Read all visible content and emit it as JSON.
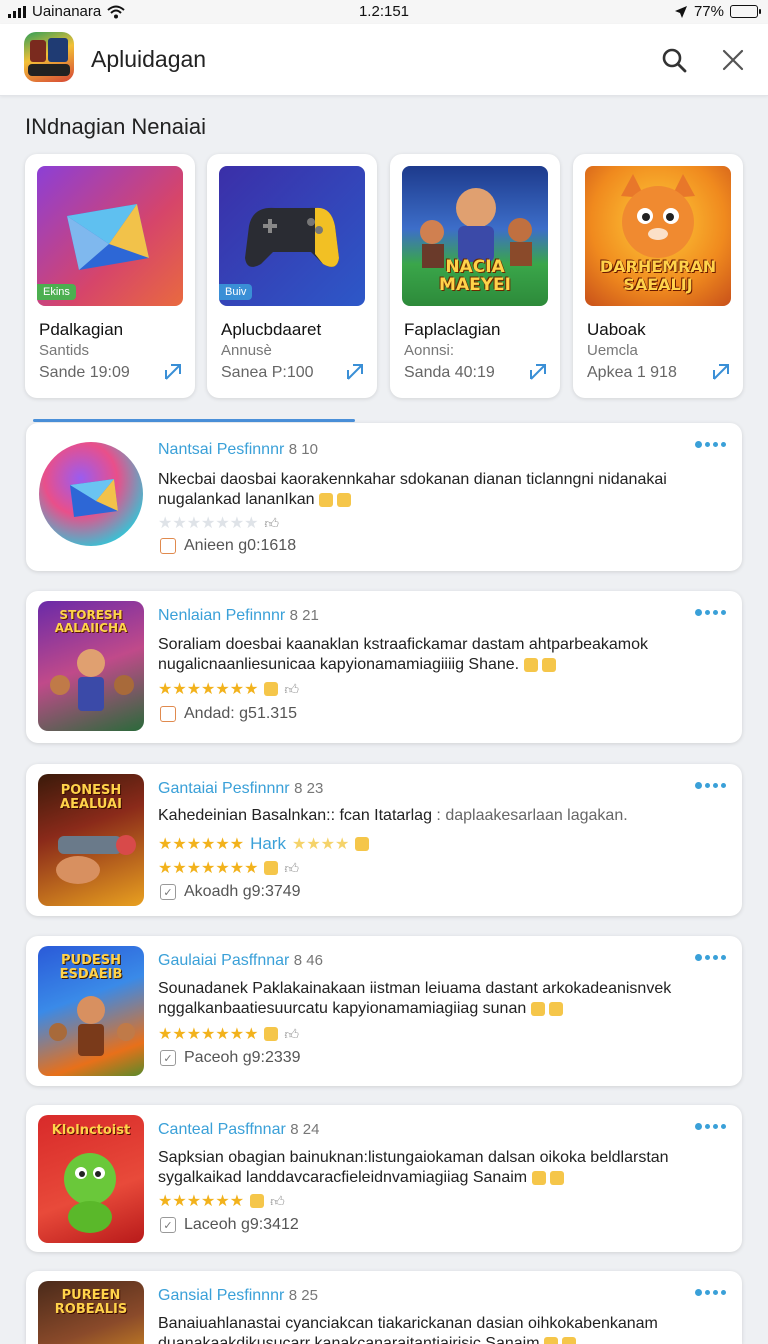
{
  "status": {
    "carrier": "Uainanara",
    "time": "1.2:151",
    "battery": "77%"
  },
  "header": {
    "title": "Apluidagan"
  },
  "section_title": "INdnagian Nenaiai",
  "featured": [
    {
      "name": "Pdalkagian",
      "sub": "Santids",
      "meta": "Sande 19:09",
      "tag": "Ekins"
    },
    {
      "name": "Aplucbdaaret",
      "sub": "Annusè",
      "meta": "Sanea P:100",
      "tag": "Buiv"
    },
    {
      "name": "Faplaclagian",
      "sub": "Aonnsi:",
      "meta": "Sanda 40:19",
      "art": "NACIA MAEYEI"
    },
    {
      "name": "Uaboak",
      "sub": "Uemcla",
      "meta": "Apkea 1 918",
      "art": "DARHEMRAN SAEALIJ"
    }
  ],
  "list": [
    {
      "title": "Nantsai Pesfinnnr",
      "num": "8 10",
      "desc1": "Nkecbai daosbai kaorakennkahar sdokanan dianan ticlanngni nidanakai",
      "desc2": "nugalankad lananIkan",
      "meta": "Anieen g0:1618"
    },
    {
      "title": "Nenlaian Pefinnnr",
      "num": "8 21",
      "desc1": "Soraliam doesbai kaanaklan kstraafickamar dastam ahtparbeakamok",
      "desc2": "nugalicnaanliesunicaa kapyionamamiagiiiig Shane.",
      "meta": "Andad: g51.315",
      "art": "STORESH AALAIICHA"
    },
    {
      "title": "Gantaiai Pesfinnnr",
      "num": "8 23",
      "desc1": "Kahedeinian Basalnkan:: fcan Itatarlag",
      "desc1b": ": daplaakesarlaan lagakan.",
      "hark": "Hark",
      "meta": "Akoadh g9:3749",
      "art": "PONESH AEALUAI"
    },
    {
      "title": "Gaulaiai Pasffnnar",
      "num": "8 46",
      "desc1": "Sounadanek Paklakainakaan iistman leiuama dastant arkokadeanisnvek",
      "desc2": "nggalkanbaatiesuurcatu kapyionamamiagiiag sunan",
      "meta": "Paceoh g9:2339",
      "art": "PUDESH ESDAEIB"
    },
    {
      "title": "Canteal Pasffnnar",
      "num": "8 24",
      "desc1": "Sapksian obagian bainuknan:listungaiokaman dalsan oikoka beldlarstan",
      "desc2": "sygalkaikad landdavcaracfieleidnvamiagiiag Sanaim",
      "meta": "Laceoh g9:3412",
      "art": "Klolnctoist"
    },
    {
      "title": "Gansial Pesfinnnr",
      "num": "8 25",
      "desc1": "Banaiuahlanastai cyanciakcan tiakarickanan dasian oihkokabenkanam",
      "desc2": "duanakaakdikusucarr kanakcanaraitantiairisic Sanaim",
      "art": "PUREEN ROBEALIS"
    }
  ]
}
